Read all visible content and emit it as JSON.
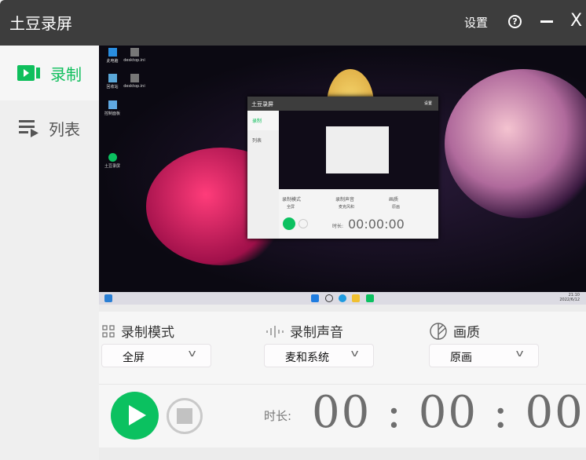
{
  "titlebar": {
    "title": "土豆录屏",
    "settings": "设置",
    "help_icon": "?",
    "close_icon": "X"
  },
  "sidebar": {
    "items": [
      {
        "label": "录制",
        "icon": "video-camera-icon",
        "active": true
      },
      {
        "label": "列表",
        "icon": "playlist-icon",
        "active": false
      }
    ]
  },
  "preview": {
    "desktop_icons": [
      "此电脑",
      "desktop.ini",
      "回收站",
      "desktop.ini",
      "控制面板",
      "土豆录屏"
    ],
    "taskbar": {
      "time": "21:10",
      "date": "2022/6/12"
    },
    "mini_window": {
      "title": "土豆录屏",
      "settings": "设置",
      "nav": [
        "录制",
        "列表"
      ],
      "sections": [
        "录制模式",
        "录制声音",
        "画质"
      ],
      "selects": [
        "全屏",
        "麦克风和",
        "原画"
      ],
      "duration_label": "时长:",
      "timer": "00:00:00"
    }
  },
  "controls": {
    "record_mode": {
      "label": "录制模式",
      "value": "全屏"
    },
    "audio": {
      "label": "录制声音",
      "value": "麦和系统"
    },
    "quality": {
      "label": "画质",
      "value": "原画"
    },
    "duration_label": "时长:",
    "timer": "00 : 00 : 00"
  },
  "colors": {
    "accent": "#0bc160",
    "titlebar": "#3d3d3d"
  }
}
